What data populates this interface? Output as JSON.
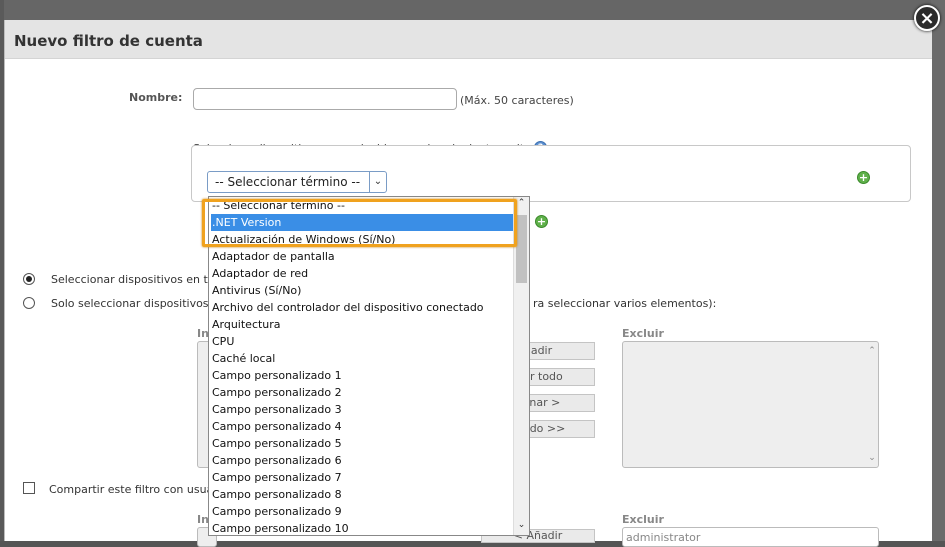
{
  "dialog": {
    "title": "Nuevo filtro de cuenta",
    "close_icon": "×"
  },
  "form": {
    "name_label": "Nombre:",
    "name_value": "",
    "name_hint": "(Máx. 50 caracteres)",
    "criteria_label": "Seleccione dispositivos que coincidan con los siguientes criterios:",
    "help_icon": "?",
    "term_select_value": "-- Seleccionar término --",
    "radio_all_label": "Seleccionar dispositivos en tod",
    "radio_only_label": "Solo seleccionar dispositivos e",
    "radio_only_suffix": "ra seleccionar varios elementos):",
    "share_label": "Compartir este filtro con usuari"
  },
  "transfer": {
    "include_header": "Inc",
    "exclude_header": "Excluir",
    "buttons": [
      "ñadir",
      "adir todo",
      "minar >",
      "r todo >>"
    ],
    "include_header_2": "Inc",
    "exclude_header_2": "Excluir",
    "button_2": "< Añadir",
    "exclude_value_2": "administrator"
  },
  "dropdown": {
    "items": [
      "-- Seleccionar término --",
      ".NET Version",
      "Actualización de Windows (Sí/No)",
      "Adaptador de pantalla",
      "Adaptador de red",
      "Antivirus (Sí/No)",
      "Archivo del controlador del dispositivo conectado",
      "Arquitectura",
      "CPU",
      "Caché local",
      "Campo personalizado 1",
      "Campo personalizado 2",
      "Campo personalizado 3",
      "Campo personalizado 4",
      "Campo personalizado 5",
      "Campo personalizado 6",
      "Campo personalizado 7",
      "Campo personalizado 8",
      "Campo personalizado 9",
      "Campo personalizado 10"
    ],
    "selected_index": 1
  }
}
